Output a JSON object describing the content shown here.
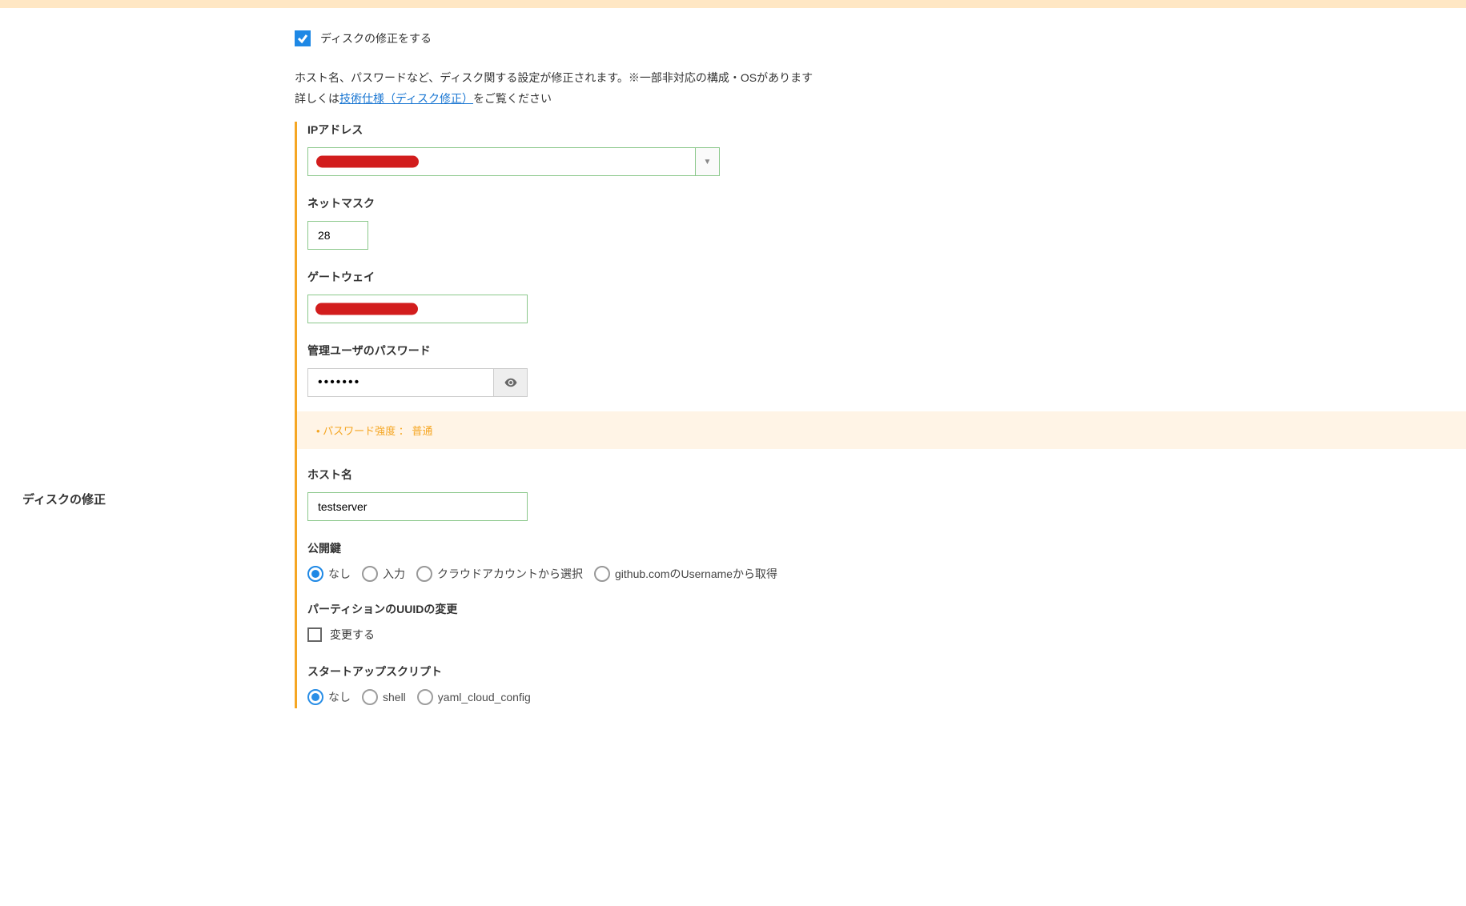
{
  "left": {
    "section_label": "ディスクの修正"
  },
  "header": {
    "checkbox_label": "ディスクの修正をする",
    "desc_line1": "ホスト名、パスワードなど、ディスク関する設定が修正されます。※一部非対応の構成・OSがあります",
    "desc_line2_prefix": "詳しくは",
    "desc_link": "技術仕様（ディスク修正）",
    "desc_line2_suffix": "をご覧ください"
  },
  "fields": {
    "ip": {
      "label": "IPアドレス"
    },
    "netmask": {
      "label": "ネットマスク",
      "value": "28"
    },
    "gateway": {
      "label": "ゲートウェイ"
    },
    "password": {
      "label": "管理ユーザのパスワード",
      "value": "•••••••",
      "strength": "パスワード強度 ： 普通"
    },
    "hostname": {
      "label": "ホスト名",
      "value": "testserver"
    },
    "pubkey": {
      "label": "公開鍵",
      "options": {
        "none": "なし",
        "input": "入力",
        "cloud": "クラウドアカウントから選択",
        "github": "github.comのUsernameから取得"
      }
    },
    "uuid": {
      "label": "パーティションのUUIDの変更",
      "checkbox_label": "変更する"
    },
    "script": {
      "label": "スタートアップスクリプト",
      "options": {
        "none": "なし",
        "shell": "shell",
        "yaml": "yaml_cloud_config"
      }
    }
  }
}
